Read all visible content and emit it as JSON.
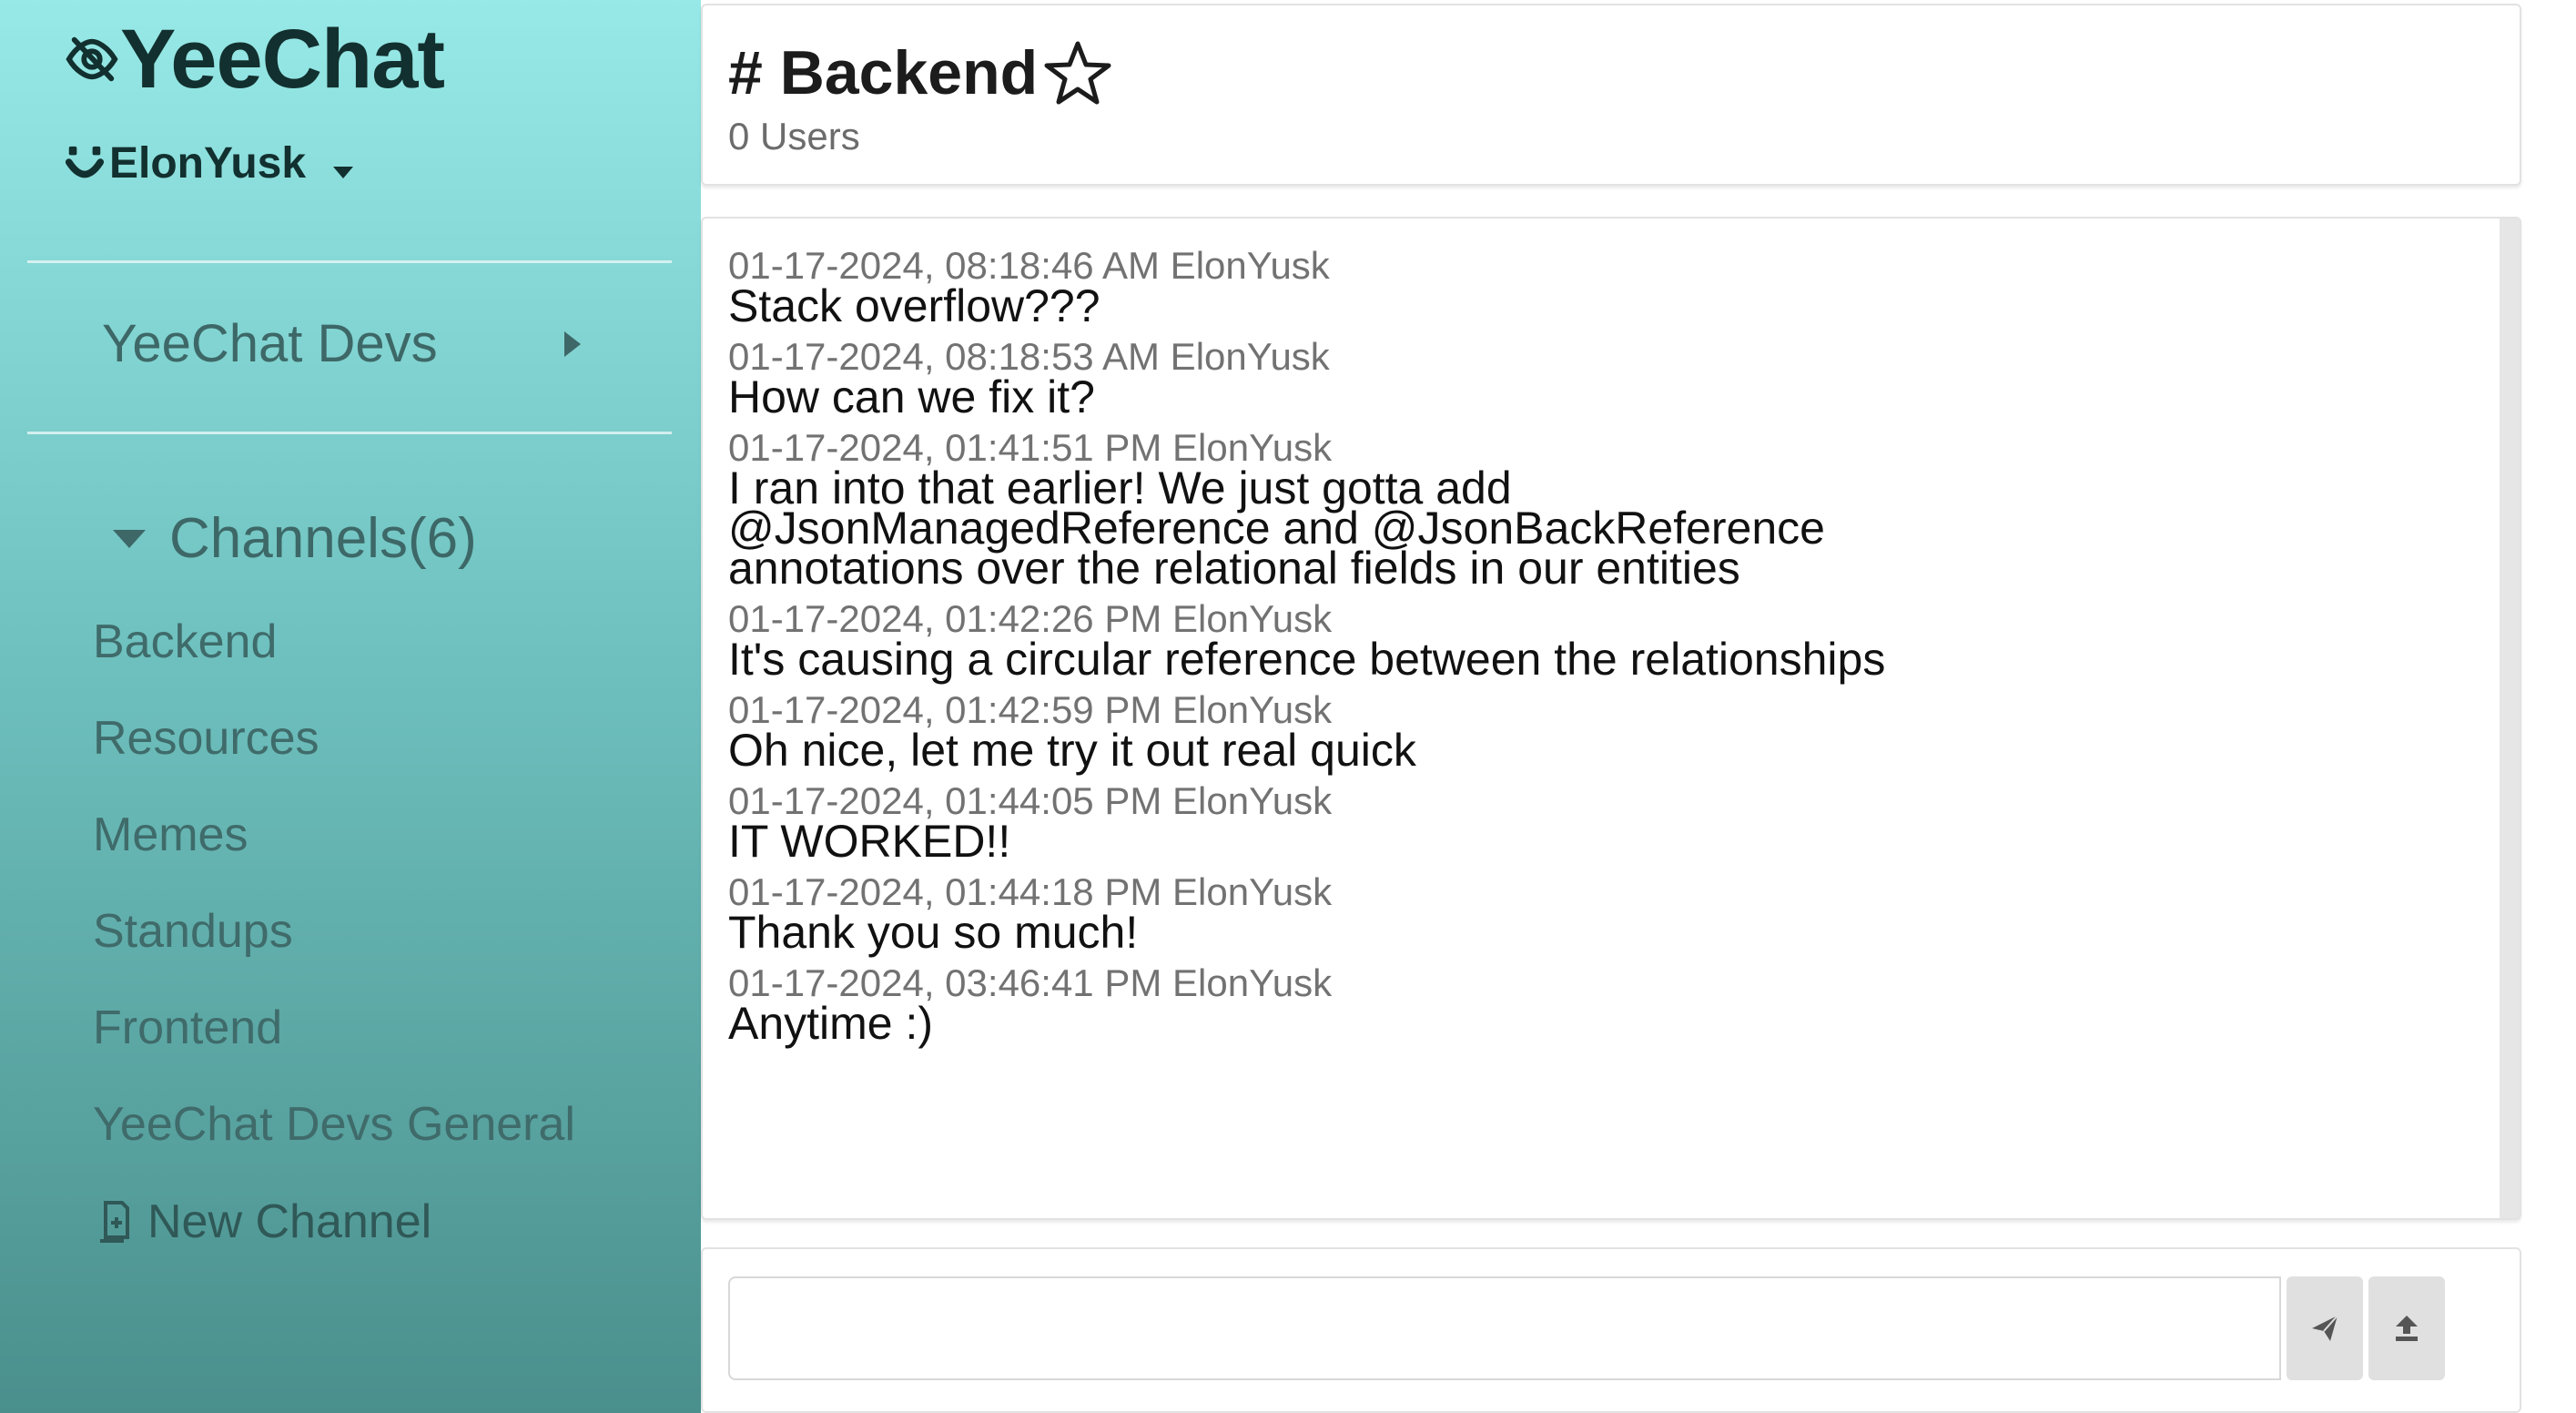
{
  "app": {
    "title": "YeeChat",
    "user": "ElonYusk"
  },
  "sidebar": {
    "server": "YeeChat Devs",
    "channels_header": "Channels(6)",
    "channels": [
      "Backend",
      "Resources",
      "Memes",
      "Standups",
      "Frontend",
      "YeeChat Devs General"
    ],
    "new_channel": "New Channel"
  },
  "header": {
    "channel": "# Backend",
    "user_count": "0 Users"
  },
  "messages": [
    {
      "meta": "01-17-2024, 08:18:46 AM ElonYusk",
      "text": "Stack overflow???"
    },
    {
      "meta": "01-17-2024, 08:18:53 AM ElonYusk",
      "text": "How can we fix it?"
    },
    {
      "meta": "01-17-2024, 01:41:51 PM ElonYusk",
      "text": "I ran into that earlier! We just gotta add @JsonManagedReference and @JsonBackReference annotations over the relational fields in our entities"
    },
    {
      "meta": "01-17-2024, 01:42:26 PM ElonYusk",
      "text": "It's causing a circular reference between the relationships"
    },
    {
      "meta": "01-17-2024, 01:42:59 PM ElonYusk",
      "text": "Oh nice, let me try it out real quick"
    },
    {
      "meta": "01-17-2024, 01:44:05 PM ElonYusk",
      "text": "IT WORKED!!"
    },
    {
      "meta": "01-17-2024, 01:44:18 PM ElonYusk",
      "text": "Thank you so much!"
    },
    {
      "meta": "01-17-2024, 03:46:41 PM ElonYusk",
      "text": "Anytime :)"
    }
  ],
  "composer": {
    "value": "",
    "placeholder": ""
  },
  "icons": {
    "brand": "eye-slash-icon",
    "user": "smile-icon",
    "user_menu": "caret-down-icon",
    "server": "caret-right-icon",
    "channels": "caret-down-icon",
    "favorite": "star-outline-icon",
    "new_channel": "add-file-icon",
    "send": "send-icon",
    "upload": "upload-icon"
  },
  "colors": {
    "sidebar_top": "#97e9e7",
    "sidebar_bottom": "#4a8f8c",
    "text_dark": "#12302f",
    "meta_gray": "#727272"
  }
}
